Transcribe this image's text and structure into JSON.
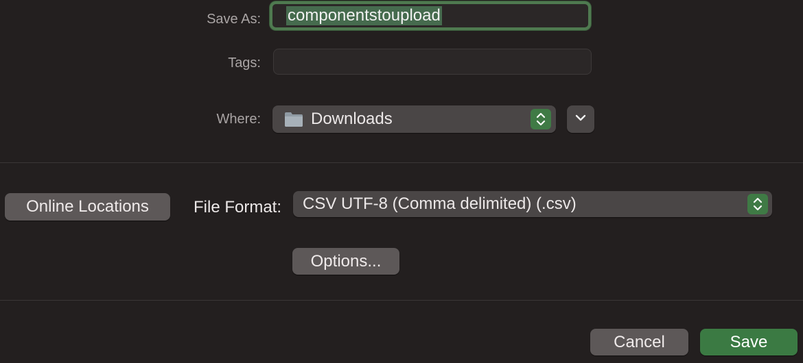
{
  "save_as": {
    "label": "Save As:",
    "value": "componentstoupload"
  },
  "tags": {
    "label": "Tags:",
    "value": ""
  },
  "where": {
    "label": "Where:",
    "selected": "Downloads"
  },
  "online_locations_label": "Online Locations",
  "file_format": {
    "label": "File Format:",
    "selected": "CSV UTF-8 (Comma delimited) (.csv)"
  },
  "options_label": "Options...",
  "cancel_label": "Cancel",
  "save_label": "Save",
  "colors": {
    "background": "#231f1f",
    "accent_green": "#3f7a45",
    "save_button": "#3b7a43",
    "popup_gray": "#4a4646",
    "button_gray": "#5d5858"
  },
  "icons": {
    "folder": "folder-icon",
    "stepper": "up-down-chevron-icon",
    "expand": "chevron-down-icon"
  }
}
